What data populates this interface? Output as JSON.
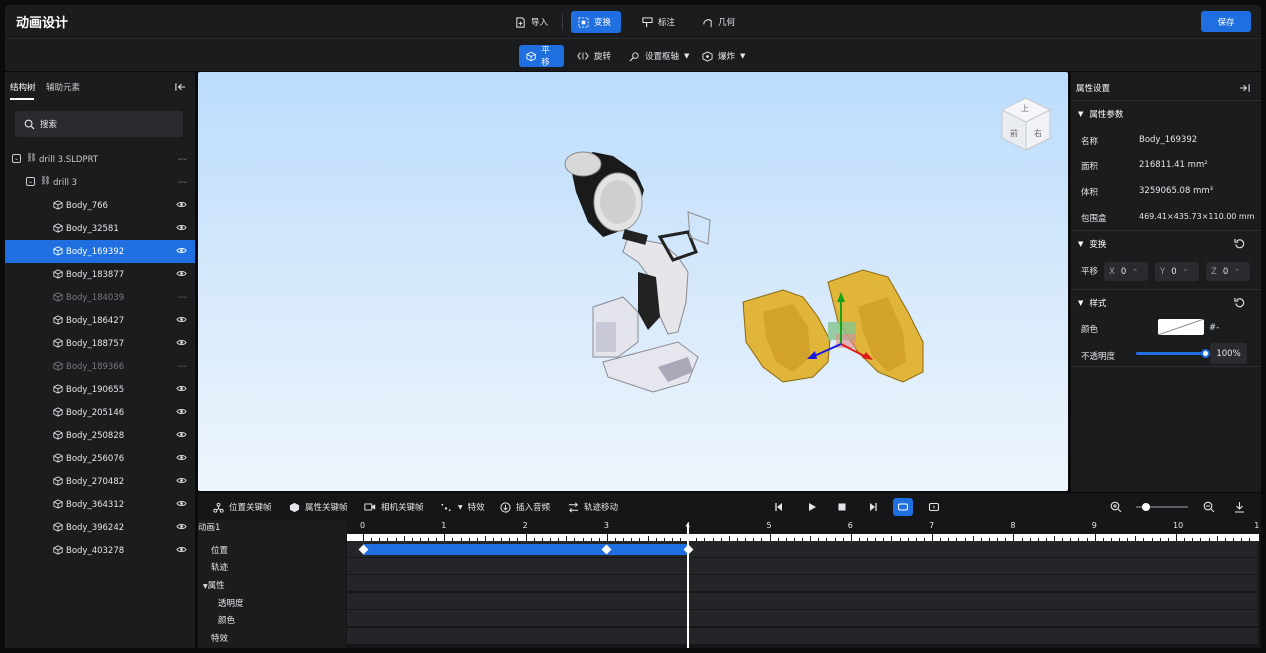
{
  "app": {
    "title": "动画设计",
    "save_label": "保存"
  },
  "top_tabs": [
    {
      "label": "导入",
      "icon": "import-icon",
      "active": false
    },
    {
      "label": "变换",
      "icon": "transform-icon",
      "active": true
    },
    {
      "label": "标注",
      "icon": "annotate-icon",
      "active": false
    },
    {
      "label": "几何",
      "icon": "geometry-icon",
      "active": false
    }
  ],
  "sub_tools": [
    {
      "label": "平移",
      "icon": "move-icon",
      "active": true
    },
    {
      "label": "旋转",
      "icon": "rotate-icon",
      "active": false
    },
    {
      "label": "设置枢轴",
      "icon": "pivot-icon",
      "active": false,
      "dropdown": true
    },
    {
      "label": "爆炸",
      "icon": "explode-icon",
      "active": false,
      "dropdown": true
    }
  ],
  "left_panel": {
    "tabs": [
      "结构树",
      "辅助元素"
    ],
    "active_tab": "结构树",
    "search_placeholder": "搜索",
    "root": "drill 3.SLDPRT",
    "subroot": "drill 3",
    "items": [
      {
        "label": "Body_766",
        "visible": true,
        "selected": false
      },
      {
        "label": "Body_32581",
        "visible": true,
        "selected": false
      },
      {
        "label": "Body_169392",
        "visible": true,
        "selected": true
      },
      {
        "label": "Body_183877",
        "visible": true,
        "selected": false
      },
      {
        "label": "Body_184039",
        "visible": false,
        "selected": false
      },
      {
        "label": "Body_186427",
        "visible": true,
        "selected": false
      },
      {
        "label": "Body_188757",
        "visible": true,
        "selected": false
      },
      {
        "label": "Body_189366",
        "visible": false,
        "selected": false
      },
      {
        "label": "Body_190655",
        "visible": true,
        "selected": false
      },
      {
        "label": "Body_205146",
        "visible": true,
        "selected": false
      },
      {
        "label": "Body_250828",
        "visible": true,
        "selected": false
      },
      {
        "label": "Body_256076",
        "visible": true,
        "selected": false
      },
      {
        "label": "Body_270482",
        "visible": true,
        "selected": false
      },
      {
        "label": "Body_364312",
        "visible": true,
        "selected": false
      },
      {
        "label": "Body_396242",
        "visible": true,
        "selected": false
      },
      {
        "label": "Body_403278",
        "visible": true,
        "selected": false
      }
    ]
  },
  "right_panel": {
    "title": "属性设置",
    "params_title": "属性参数",
    "params": [
      {
        "label": "名称",
        "value": "Body_169392"
      },
      {
        "label": "面积",
        "value": "216811.41 mm²"
      },
      {
        "label": "体积",
        "value": "3259065.08 mm³"
      },
      {
        "label": "包围盒",
        "value": "469.41×435.73×110.00 mm"
      }
    ],
    "transform_title": "变换",
    "translate_label": "平移",
    "translate": {
      "x": "0",
      "y": "0",
      "z": "0",
      "x_label": "X",
      "y_label": "Y",
      "z_label": "Z"
    },
    "style_title": "样式",
    "color_label": "颜色",
    "color_value": "#-",
    "opacity_label": "不透明度",
    "opacity_value": "100%",
    "opacity_fraction": 1.0
  },
  "viewcube": {
    "top": "上",
    "front": "前",
    "right": "右"
  },
  "timeline": {
    "tools": [
      {
        "label": "位置关键帧",
        "icon": "position-keyframe-icon"
      },
      {
        "label": "属性关键帧",
        "icon": "property-keyframe-icon"
      },
      {
        "label": "相机关键帧",
        "icon": "camera-keyframe-icon"
      },
      {
        "label": "特效",
        "icon": "effect-icon",
        "dropdown": true
      },
      {
        "label": "插入音频",
        "icon": "audio-icon"
      },
      {
        "label": "轨迹移动",
        "icon": "path-move-icon"
      }
    ],
    "animation_name": "动画1",
    "tracks": [
      "位置",
      "轨迹",
      "属性",
      "透明度",
      "颜色",
      "特效"
    ],
    "ruler": [
      "0",
      "1",
      "2",
      "3",
      "4",
      "5",
      "6",
      "7",
      "8",
      "9",
      "10",
      "1"
    ],
    "keyframes": [
      0,
      3,
      4
    ],
    "bar_range": [
      0,
      4
    ],
    "playhead": 4,
    "zoom_fraction": 0.2,
    "colors": {
      "accent": "#1f6fe0",
      "track": "#242528",
      "body_gold": "#e1b43a"
    }
  }
}
